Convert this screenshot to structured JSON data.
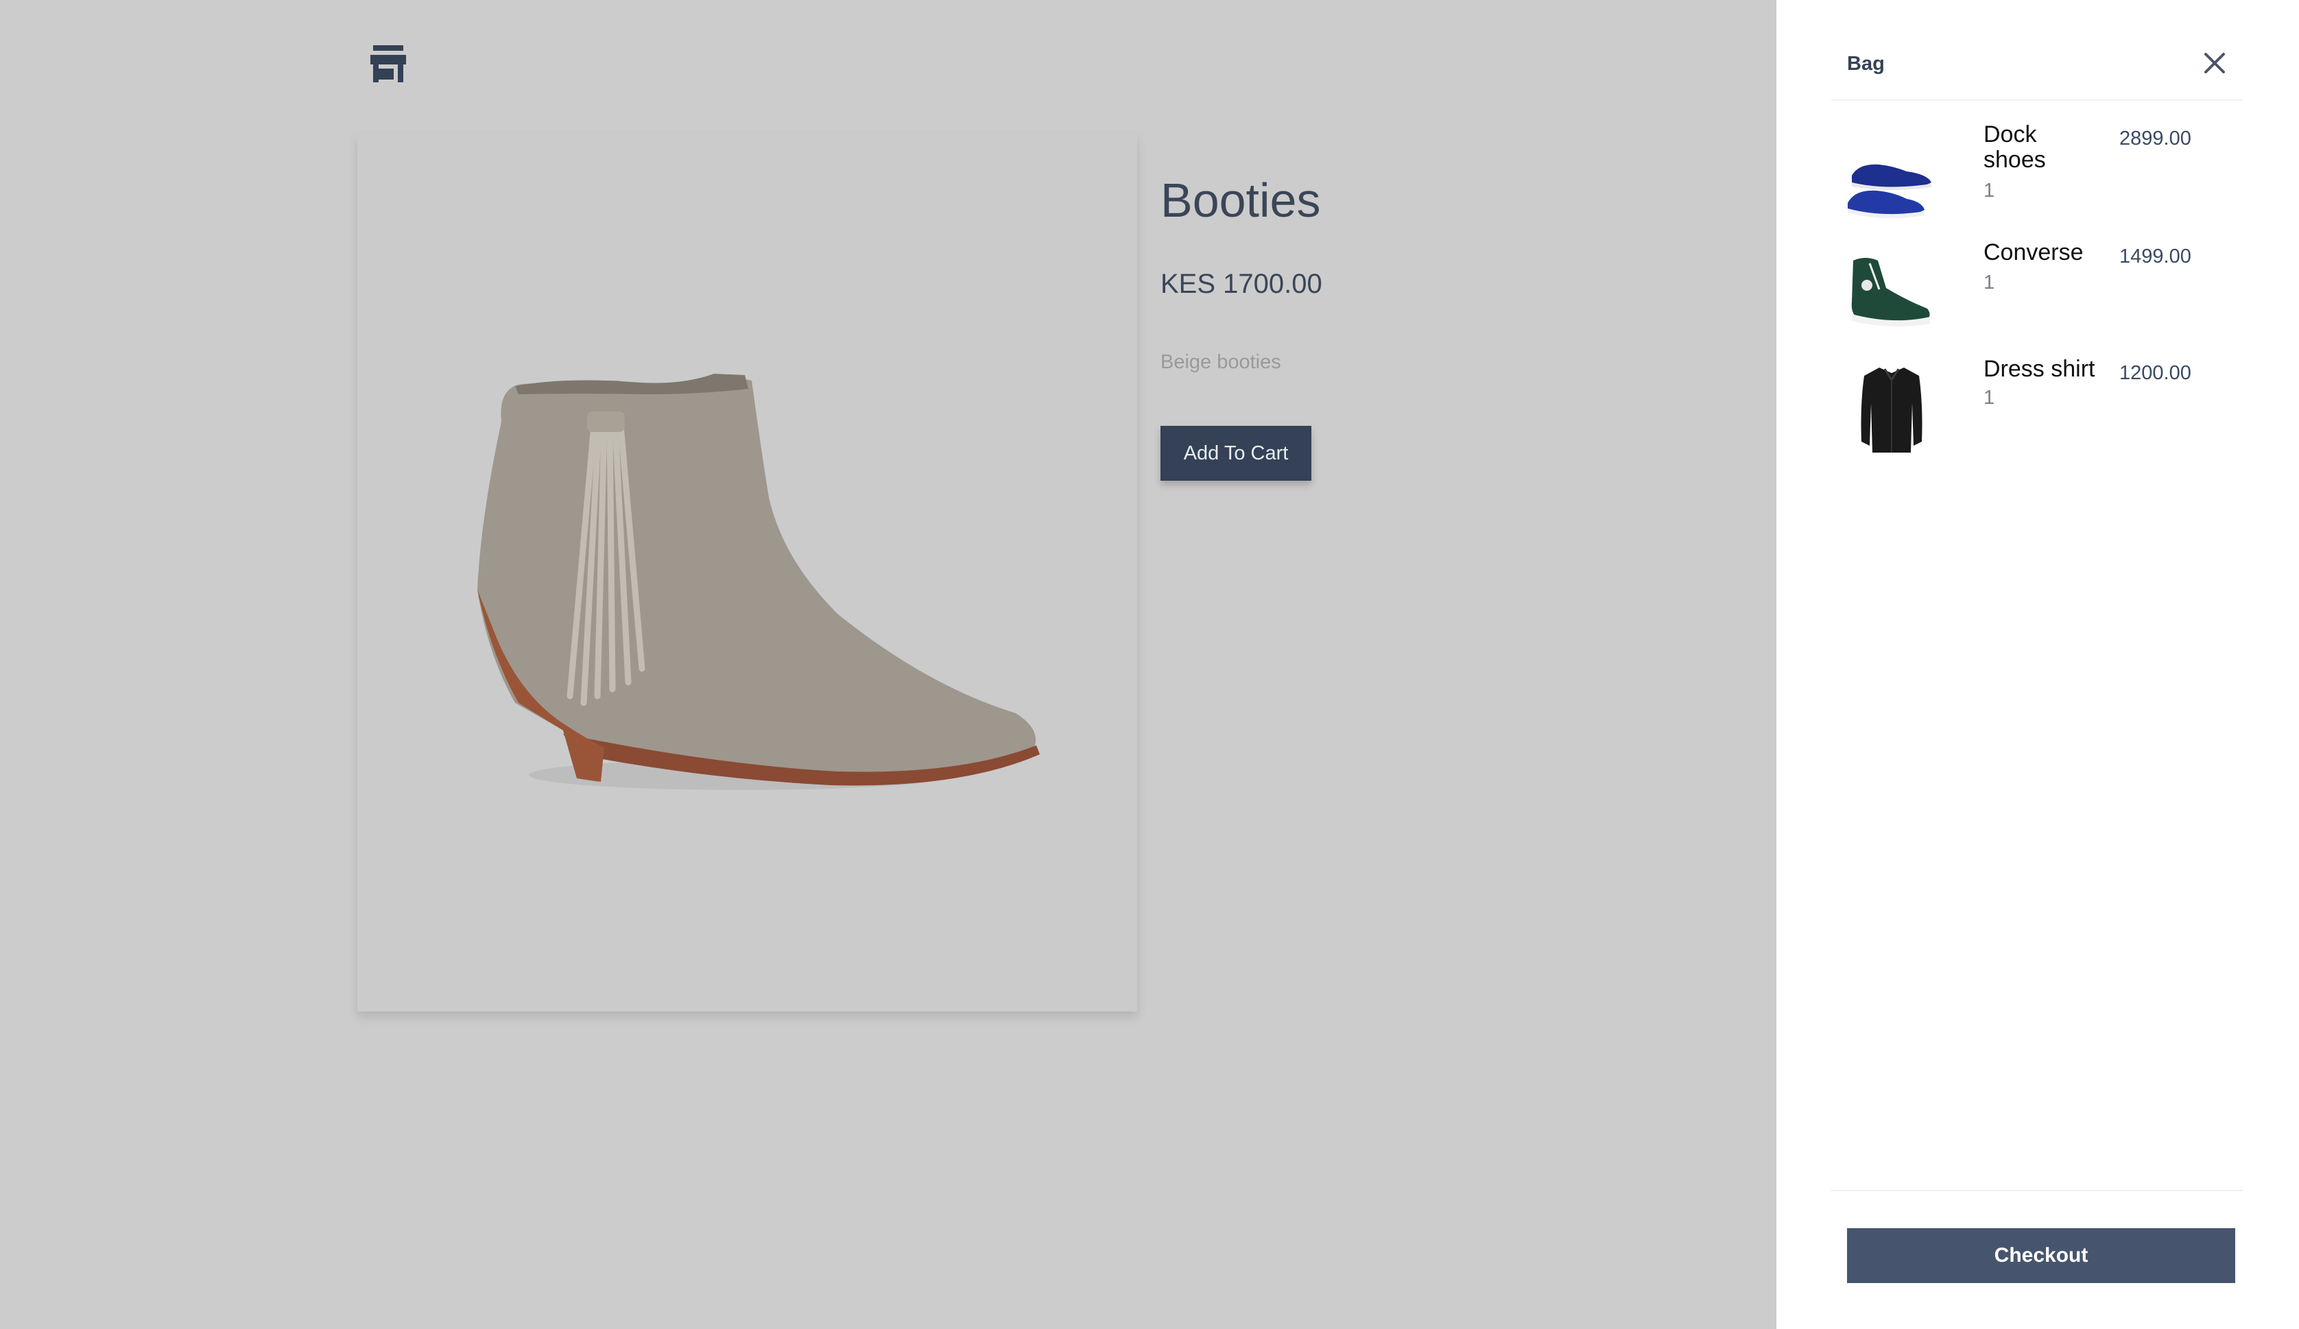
{
  "header": {
    "store_icon": "store-icon"
  },
  "product": {
    "title": "Booties",
    "price": "KES 1700.00",
    "description": "Beige booties",
    "add_to_cart_label": "Add To Cart",
    "image": "beige-fringe-ankle-bootie"
  },
  "bag": {
    "title": "Bag",
    "close_icon": "close-icon",
    "items": [
      {
        "name": "Dock shoes",
        "qty": "1",
        "price": "2899.00",
        "image": "blue-dock-shoes"
      },
      {
        "name": "Converse",
        "qty": "1",
        "price": "1499.00",
        "image": "green-high-top-sneaker"
      },
      {
        "name": "Dress shirt",
        "qty": "1",
        "price": "1200.00",
        "image": "black-dress-shirt"
      }
    ],
    "checkout_label": "Checkout"
  },
  "colors": {
    "overlay_background": "#cccccc",
    "primary_button": "#344156",
    "checkout_button": "#47546d",
    "text_dark": "#3a4658"
  }
}
